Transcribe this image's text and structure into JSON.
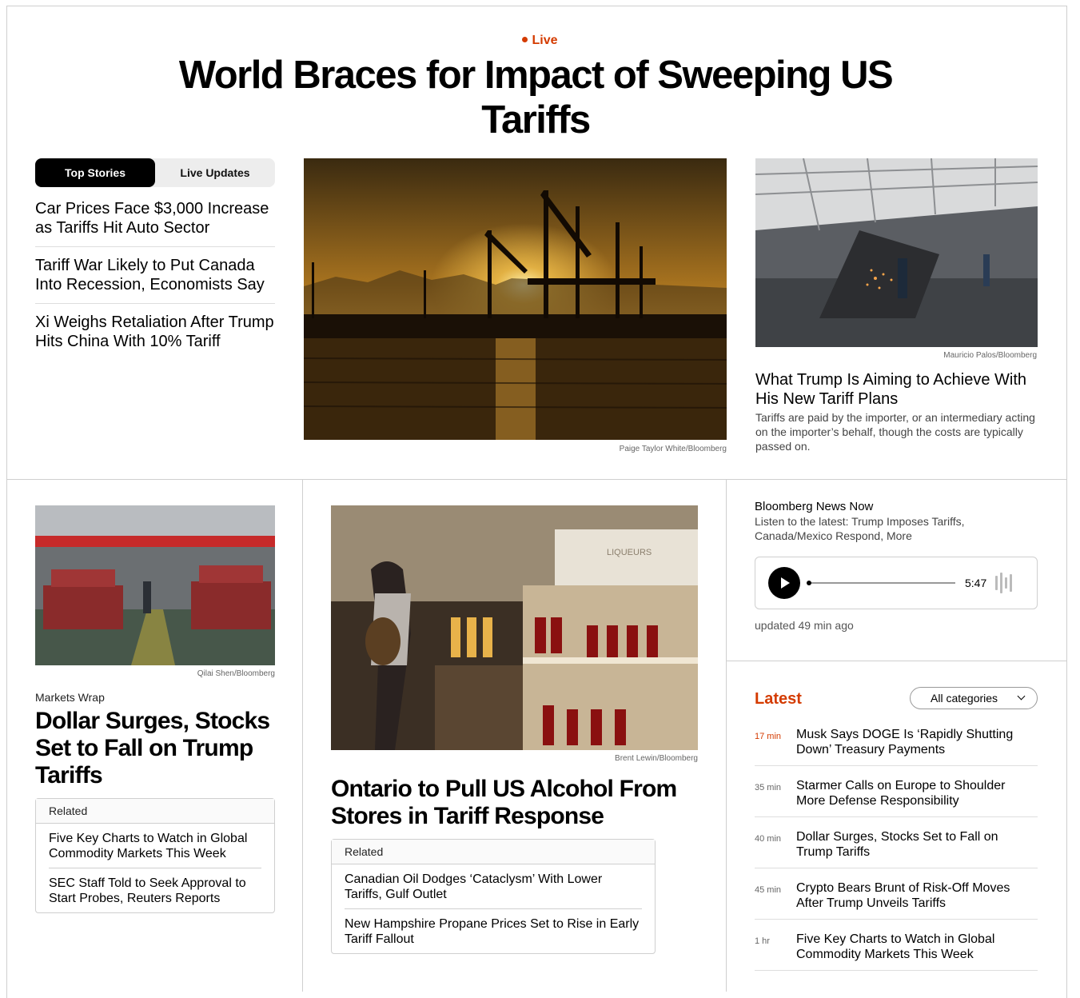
{
  "hero": {
    "live_label": "Live",
    "headline": "World Braces for Impact of Sweeping US Tariffs"
  },
  "tabs": [
    {
      "label": "Top Stories",
      "active": true
    },
    {
      "label": "Live Updates",
      "active": false
    }
  ],
  "top_stories": [
    "Car Prices Face $3,000 Increase as Tariffs Hit Auto Sector",
    "Tariff War Likely to Put Canada Into Recession, Economists Say",
    "Xi Weighs Retaliation After Trump Hits China With 10% Tariff"
  ],
  "main_photo": {
    "credit": "Paige Taylor White/Bloomberg"
  },
  "feature": {
    "credit": "Mauricio Palos/Bloomberg",
    "title": "What Trump Is Aiming to Achieve With His New Tariff Plans",
    "description": "Tariffs are paid by the importer, or an intermediary acting on the importer’s behalf, though the costs are typically passed on."
  },
  "markets": {
    "credit": "Qilai Shen/Bloomberg",
    "kicker": "Markets Wrap",
    "title": "Dollar Surges, Stocks Set to Fall on Trump Tariffs",
    "related_label": "Related",
    "related": [
      "Five Key Charts to Watch in Global Commodity Markets This Week",
      "SEC Staff Told to Seek Approval to Start Probes, Reuters Reports"
    ]
  },
  "ontario": {
    "credit": "Brent Lewin/Bloomberg",
    "title": "Ontario to Pull US Alcohol From Stores in Tariff Response",
    "related_label": "Related",
    "related": [
      "Canadian Oil Dodges ‘Cataclysm’ With Lower Tariffs, Gulf Outlet",
      "New Hampshire Propane Prices Set to Rise in Early Tariff Fallout"
    ]
  },
  "podcast": {
    "title": "Bloomberg News Now",
    "description": "Listen to the latest: Trump Imposes Tariffs, Canada/Mexico Respond, More",
    "duration": "5:47",
    "updated": "updated 49 min ago"
  },
  "latest": {
    "label": "Latest",
    "filter_value": "All categories",
    "items": [
      {
        "time": "17 min",
        "title": "Musk Says DOGE Is ‘Rapidly Shutting Down’ Treasury Payments"
      },
      {
        "time": "35 min",
        "title": "Starmer Calls on Europe to Shoulder More Defense Responsibility"
      },
      {
        "time": "40 min",
        "title": "Dollar Surges, Stocks Set to Fall on Trump Tariffs"
      },
      {
        "time": "45 min",
        "title": "Crypto Bears Brunt of Risk-Off Moves After Trump Unveils Tariffs"
      },
      {
        "time": "1 hr",
        "title": "Five Key Charts to Watch in Global Commodity Markets This Week"
      }
    ]
  },
  "colors": {
    "accent": "#d43b00",
    "border": "#cfcfcf"
  }
}
